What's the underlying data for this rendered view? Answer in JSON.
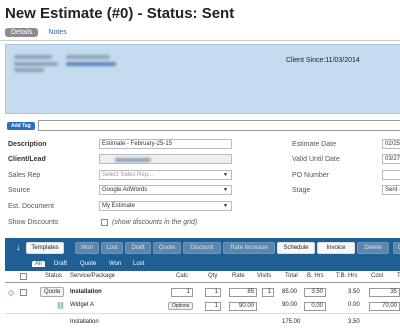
{
  "title": "New Estimate (#0) - Status: Sent",
  "tabs": {
    "details": "Details",
    "notes": "Notes"
  },
  "client": {
    "since": "Client Since:11/03/2014"
  },
  "tags": {
    "add_label": "Add Tag",
    "input_value": ""
  },
  "form": {
    "description": {
      "label": "Description",
      "value": "Estimate - February-25-15"
    },
    "client_lead": {
      "label": "Client/Lead",
      "value": ""
    },
    "sales_rep": {
      "label": "Sales Rep",
      "placeholder": "Select Sales Rep..."
    },
    "source": {
      "label": "Source",
      "value": "Google AdWords"
    },
    "est_document": {
      "label": "Est. Document",
      "value": "My Estimate"
    },
    "show_discounts": {
      "label": "Show Discounts",
      "text": "(show discounts in the grid)",
      "checked": false
    },
    "estimate_date": {
      "label": "Estimate Date",
      "value": "02/25"
    },
    "valid_until": {
      "label": "Valid Until Date",
      "value": "03/27"
    },
    "po_number": {
      "label": "PO Number",
      "value": ""
    },
    "stage": {
      "label": "Stage",
      "value": "Sent -"
    }
  },
  "toolbar": {
    "sort_icon": "down-arrow-icon",
    "buttons": [
      {
        "label": "Templates",
        "active": true
      },
      {
        "label": "Won",
        "active": false
      },
      {
        "label": "Lost",
        "active": false
      },
      {
        "label": "Draft",
        "active": false
      },
      {
        "label": "Quote",
        "active": false
      },
      {
        "label": "Discount",
        "active": false
      },
      {
        "label": "Rate Increase",
        "active": false
      },
      {
        "label": "Schedule",
        "active": true
      },
      {
        "label": "Invoice",
        "active": true
      },
      {
        "label": "Delete",
        "active": false
      },
      {
        "label": "C",
        "active": false
      }
    ]
  },
  "filters": [
    "All",
    "Draft",
    "Quote",
    "Won",
    "Lost"
  ],
  "table": {
    "headers": {
      "status": "Status",
      "service": "Service/Package",
      "calc": "Calc",
      "qty": "Qty",
      "rate": "Rate",
      "visits": "Visits",
      "total": "Total",
      "bhrs": "B. Hrs",
      "tbhrs": "T.B. Hrs",
      "cost": "Cost",
      "more": "T"
    },
    "rows": [
      {
        "status": "Quote",
        "service": "Installation",
        "calc": "1",
        "qty": "1",
        "rate": "85",
        "visits": "1",
        "total": "85.00",
        "bhrs": "3.50",
        "tbhrs": "3.50",
        "cost": "35"
      },
      {
        "service": "Widget A",
        "options": "Options",
        "qty": "1",
        "rate": "90.00",
        "total": "90.00",
        "bhrs": "0.00",
        "tbhrs": "0.00",
        "cost": "70.00"
      }
    ],
    "subtotal": {
      "service": "Installation",
      "total": "175.00",
      "tbhrs": "3.50"
    }
  },
  "colors": {
    "accent_bar": "#1f5f93",
    "client_panel": "#c5dcef",
    "link": "#2a5db0"
  }
}
